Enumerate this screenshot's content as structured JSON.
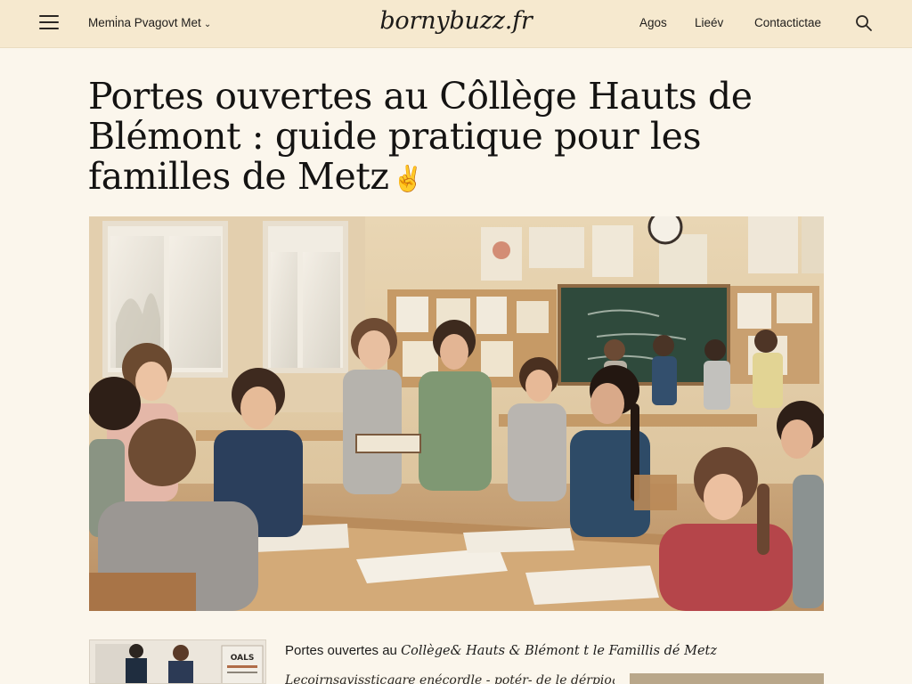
{
  "header": {
    "menu_label": "Menu",
    "dropdown_label": "Memi̇na Pvagovt Met",
    "logo": "bornybuzz.fr",
    "nav": [
      "Agos",
      "Lieév",
      "Contactictae"
    ]
  },
  "article": {
    "title": "Portes ouvertes au Côllège Hauts de Blémont : guide pratique pour les familles de Metz",
    "title_mark": "✌"
  },
  "teaser": {
    "title_plain": "Portes ouvertes au ",
    "title_italic": "Collège& Hauts & Blémont t le Famillis dé Metz",
    "subline": "Lecoirnsavissticgare enécordle - potér- de le dérpiogn",
    "thumb_text": "OALS"
  },
  "colors": {
    "header_bg": "#f6e9cf",
    "page_bg": "#fbf6ec",
    "text": "#141312"
  }
}
